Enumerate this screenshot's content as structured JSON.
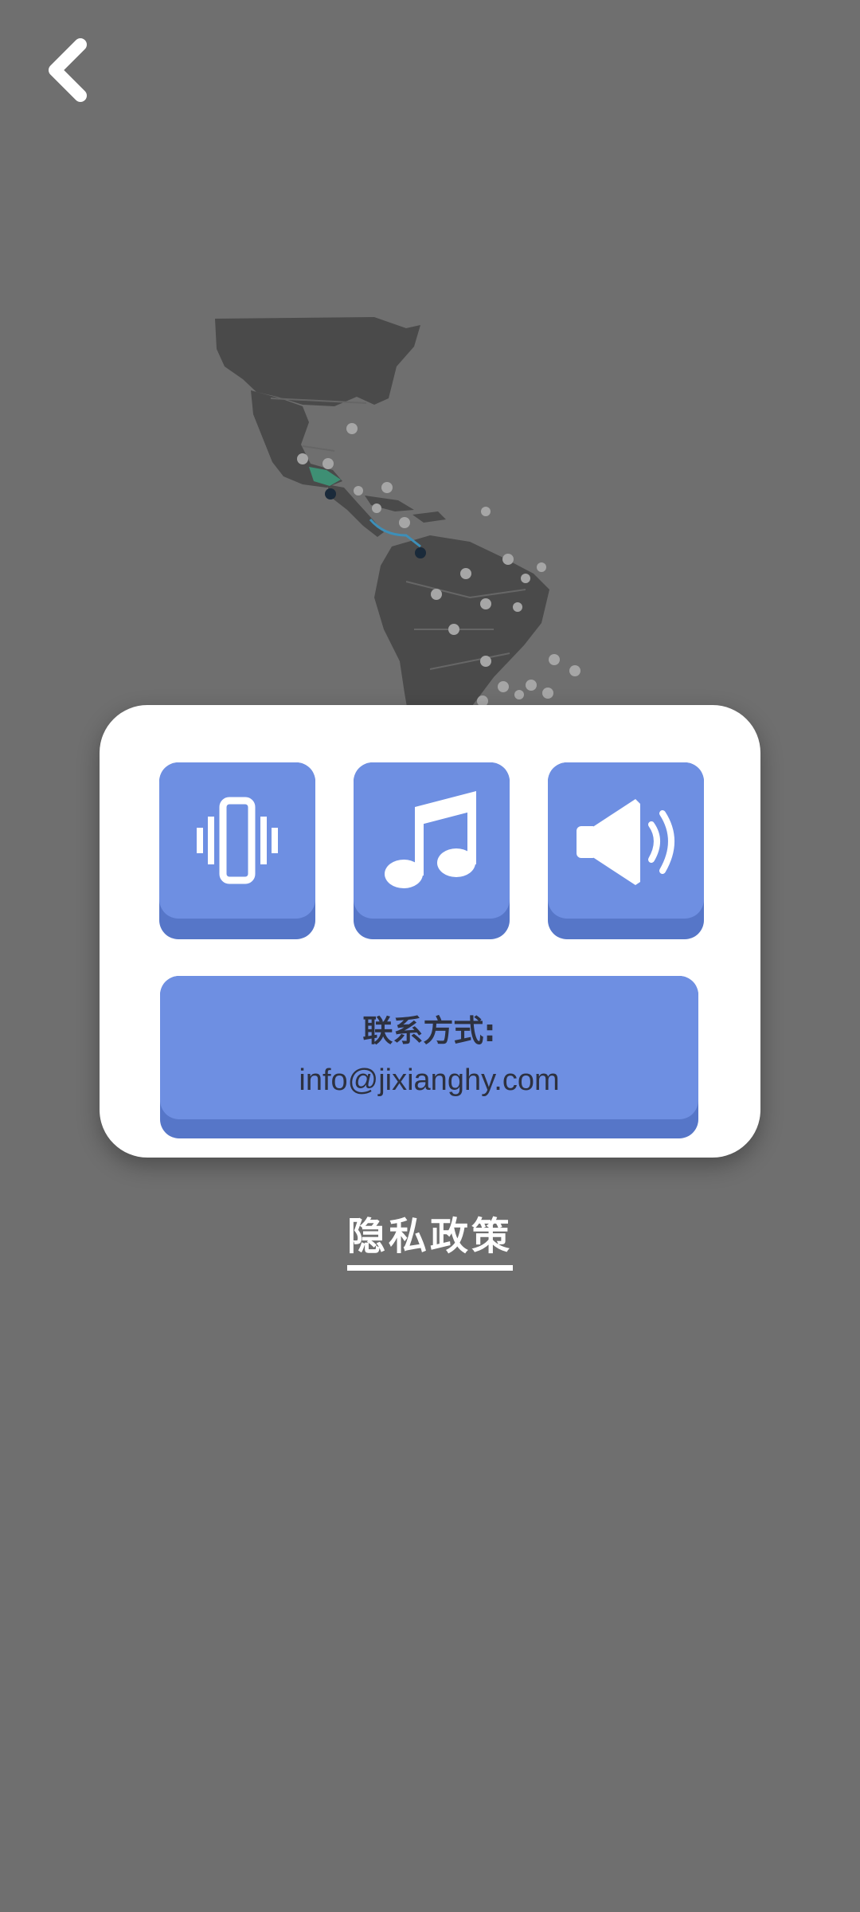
{
  "header": {
    "back_icon": "chevron-left-icon"
  },
  "background": {
    "map_icon": "americas-map",
    "color": "#6f6f6f"
  },
  "settings": {
    "vibration_icon": "vibration-icon",
    "music_icon": "music-note-icon",
    "sound_icon": "speaker-icon",
    "accent": "#6e8fe2",
    "accent_shadow": "#5676c8"
  },
  "contact": {
    "title": "联系方式:",
    "email": "info@jixianghy.com"
  },
  "footer": {
    "privacy_label": "隐私政策"
  }
}
